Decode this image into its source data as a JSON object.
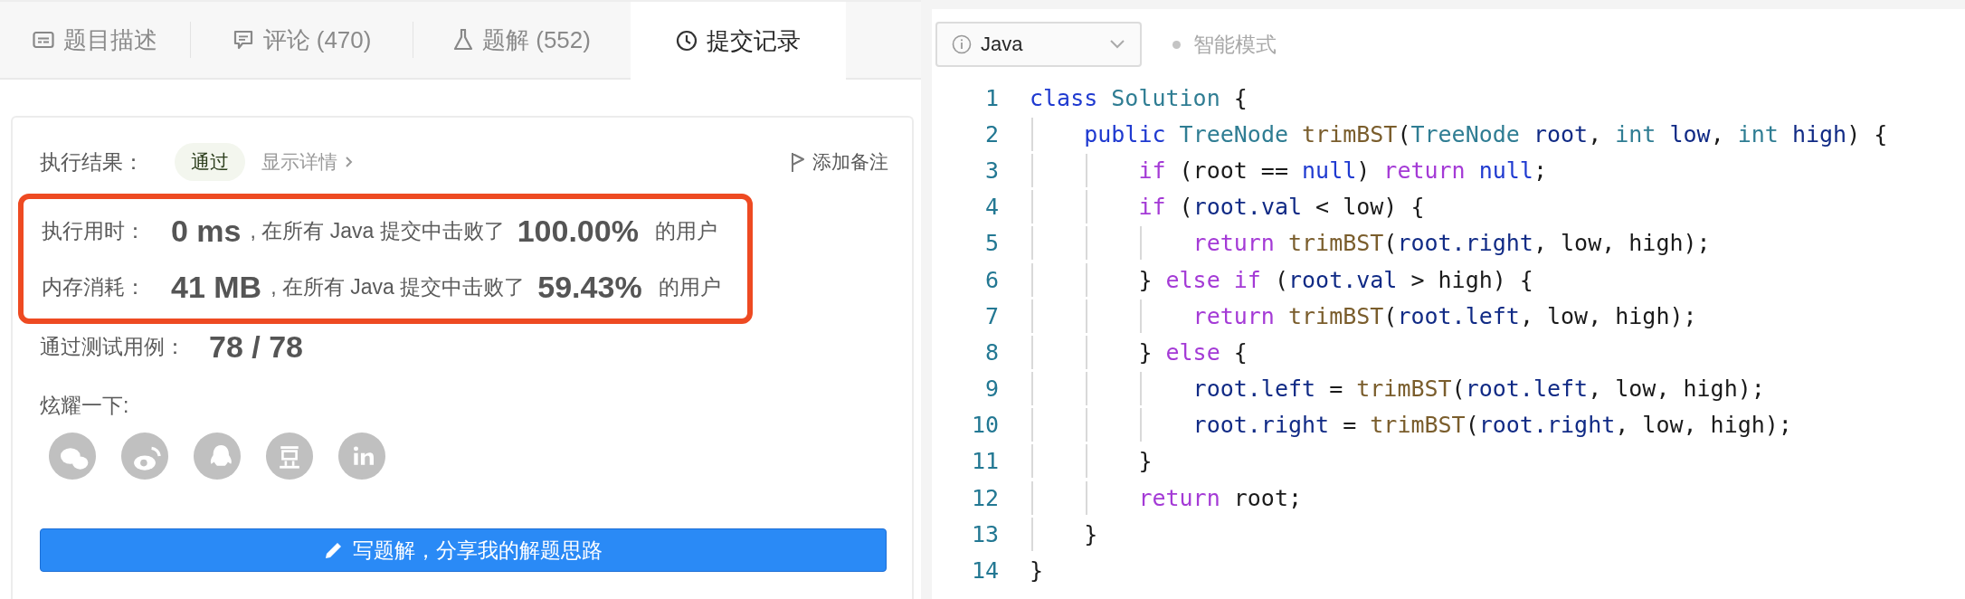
{
  "tabs": [
    {
      "label": "题目描述",
      "selected": false
    },
    {
      "label": "评论 (470)",
      "selected": false
    },
    {
      "label": "题解 (552)",
      "selected": false
    },
    {
      "label": "提交记录",
      "selected": true
    }
  ],
  "result": {
    "label": "执行结果：",
    "status": "通过",
    "details_link": "显示详情",
    "note_button": "添加备注"
  },
  "stats": [
    {
      "label": "执行用时：",
      "value": "0 ms",
      "text": ", 在所有 Java 提交中击败了",
      "percent": "100.00%",
      "suffix": "的用户"
    },
    {
      "label": "内存消耗：",
      "value": "41 MB",
      "text": ", 在所有 Java 提交中击败了",
      "percent": "59.43%",
      "suffix": "的用户"
    }
  ],
  "tests": {
    "label": "通过测试用例：",
    "value": "78 / 78"
  },
  "share": {
    "label": "炫耀一下:"
  },
  "write_button": "写题解，分享我的解题思路",
  "editor": {
    "language": "Java",
    "mode_label": "智能模式",
    "lines": [
      {
        "number": "1",
        "tokens": [
          {
            "text": "class ",
            "kind": "storage"
          },
          {
            "text": "Solution",
            "kind": "type"
          },
          {
            "text": " {",
            "kind": "plain"
          }
        ]
      },
      {
        "number": "2",
        "tokens": [
          {
            "text": "    public ",
            "kind": "storage"
          },
          {
            "text": "TreeNode ",
            "kind": "type"
          },
          {
            "text": "trimBST",
            "kind": "function"
          },
          {
            "text": "(",
            "kind": "plain"
          },
          {
            "text": "TreeNode ",
            "kind": "type"
          },
          {
            "text": "root",
            "kind": "variable"
          },
          {
            "text": ", ",
            "kind": "plain"
          },
          {
            "text": "int ",
            "kind": "type"
          },
          {
            "text": "low",
            "kind": "variable"
          },
          {
            "text": ", ",
            "kind": "plain"
          },
          {
            "text": "int ",
            "kind": "type"
          },
          {
            "text": "high",
            "kind": "variable"
          },
          {
            "text": ") {",
            "kind": "plain"
          }
        ]
      },
      {
        "number": "3",
        "tokens": [
          {
            "text": "        if",
            "kind": "control"
          },
          {
            "text": " (root == ",
            "kind": "plain"
          },
          {
            "text": "null",
            "kind": "storage"
          },
          {
            "text": ") ",
            "kind": "plain"
          },
          {
            "text": "return ",
            "kind": "control"
          },
          {
            "text": "null",
            "kind": "storage"
          },
          {
            "text": ";",
            "kind": "plain"
          }
        ]
      },
      {
        "number": "4",
        "tokens": [
          {
            "text": "        if",
            "kind": "control"
          },
          {
            "text": " (",
            "kind": "plain"
          },
          {
            "text": "root.val",
            "kind": "variable"
          },
          {
            "text": " < low) {",
            "kind": "plain"
          }
        ]
      },
      {
        "number": "5",
        "tokens": [
          {
            "text": "            return ",
            "kind": "control"
          },
          {
            "text": "trimBST",
            "kind": "function"
          },
          {
            "text": "(",
            "kind": "plain"
          },
          {
            "text": "root.right",
            "kind": "variable"
          },
          {
            "text": ", low, high);",
            "kind": "plain"
          }
        ]
      },
      {
        "number": "6",
        "tokens": [
          {
            "text": "        } ",
            "kind": "plain"
          },
          {
            "text": "else if",
            "kind": "control"
          },
          {
            "text": " (",
            "kind": "plain"
          },
          {
            "text": "root.val",
            "kind": "variable"
          },
          {
            "text": " > high) {",
            "kind": "plain"
          }
        ]
      },
      {
        "number": "7",
        "tokens": [
          {
            "text": "            return ",
            "kind": "control"
          },
          {
            "text": "trimBST",
            "kind": "function"
          },
          {
            "text": "(",
            "kind": "plain"
          },
          {
            "text": "root.left",
            "kind": "variable"
          },
          {
            "text": ", low, high);",
            "kind": "plain"
          }
        ]
      },
      {
        "number": "8",
        "tokens": [
          {
            "text": "        } ",
            "kind": "plain"
          },
          {
            "text": "else",
            "kind": "control"
          },
          {
            "text": " {",
            "kind": "plain"
          }
        ]
      },
      {
        "number": "9",
        "tokens": [
          {
            "text": "            root.left",
            "kind": "variable"
          },
          {
            "text": " = ",
            "kind": "plain"
          },
          {
            "text": "trimBST",
            "kind": "function"
          },
          {
            "text": "(",
            "kind": "plain"
          },
          {
            "text": "root.left",
            "kind": "variable"
          },
          {
            "text": ", low, high);",
            "kind": "plain"
          }
        ]
      },
      {
        "number": "10",
        "tokens": [
          {
            "text": "            root.right",
            "kind": "variable"
          },
          {
            "text": " = ",
            "kind": "plain"
          },
          {
            "text": "trimBST",
            "kind": "function"
          },
          {
            "text": "(",
            "kind": "plain"
          },
          {
            "text": "root.right",
            "kind": "variable"
          },
          {
            "text": ", low, high);",
            "kind": "plain"
          }
        ]
      },
      {
        "number": "11",
        "tokens": [
          {
            "text": "        }",
            "kind": "plain"
          }
        ]
      },
      {
        "number": "12",
        "tokens": [
          {
            "text": "        return",
            "kind": "control"
          },
          {
            "text": " root;",
            "kind": "plain"
          }
        ]
      },
      {
        "number": "13",
        "tokens": [
          {
            "text": "    }",
            "kind": "plain"
          }
        ]
      },
      {
        "number": "14",
        "tokens": [
          {
            "text": "}",
            "kind": "plain"
          }
        ]
      }
    ]
  }
}
